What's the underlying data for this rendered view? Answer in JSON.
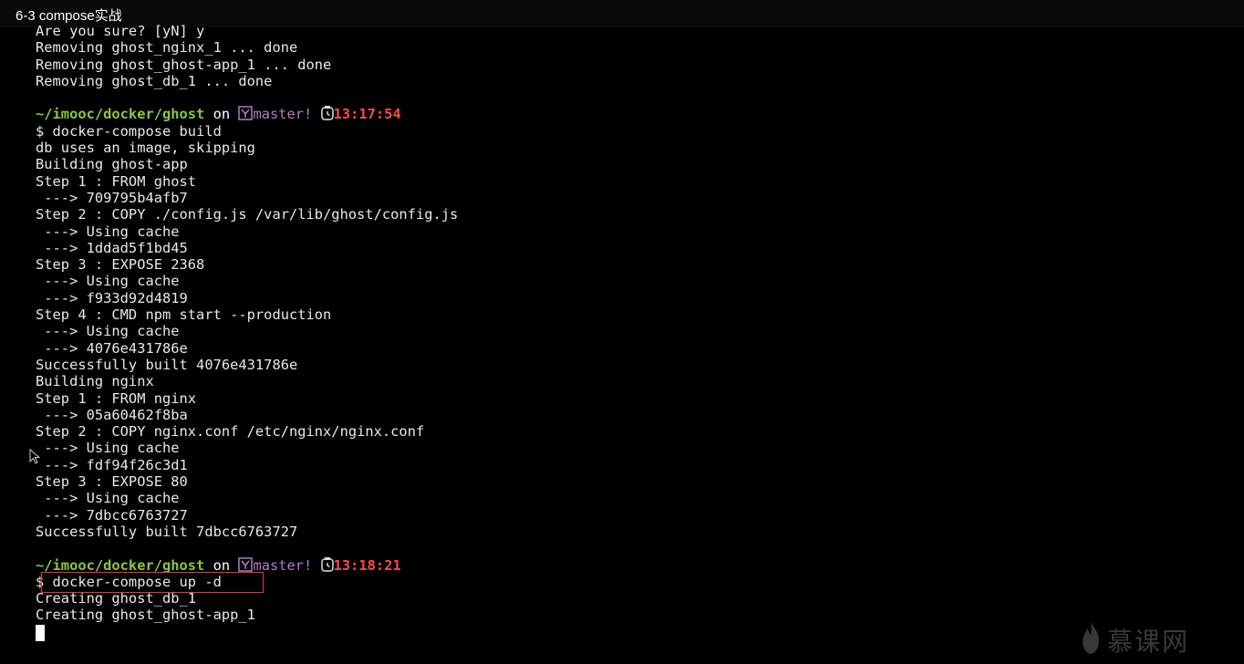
{
  "window": {
    "title": "6-3 compose实战"
  },
  "terminal": {
    "lines_top": [
      "Are you sure? [yN] y",
      "Removing ghost_nginx_1 ... done",
      "Removing ghost_ghost-app_1 ... done",
      "Removing ghost_db_1 ... done",
      ""
    ],
    "prompt1": {
      "path": "~/imooc/docker/ghost",
      "on": "on",
      "branch": "master!",
      "time": "13:17:54"
    },
    "lines_mid": [
      "$ docker-compose build",
      "db uses an image, skipping",
      "Building ghost-app",
      "Step 1 : FROM ghost",
      " ---> 709795b4afb7",
      "Step 2 : COPY ./config.js /var/lib/ghost/config.js",
      " ---> Using cache",
      " ---> 1ddad5f1bd45",
      "Step 3 : EXPOSE 2368",
      " ---> Using cache",
      " ---> f933d92d4819",
      "Step 4 : CMD npm start --production",
      " ---> Using cache",
      " ---> 4076e431786e",
      "Successfully built 4076e431786e",
      "Building nginx",
      "Step 1 : FROM nginx",
      " ---> 05a60462f8ba",
      "Step 2 : COPY nginx.conf /etc/nginx/nginx.conf",
      " ---> Using cache",
      " ---> fdf94f26c3d1",
      "Step 3 : EXPOSE 80",
      " ---> Using cache",
      " ---> 7dbcc6763727",
      "Successfully built 7dbcc6763727",
      ""
    ],
    "prompt2": {
      "path": "~/imooc/docker/ghost",
      "on": "on",
      "branch": "master!",
      "time": "13:18:21"
    },
    "lines_bottom": [
      "$ docker-compose up -d",
      "Creating ghost_db_1",
      "Creating ghost_ghost-app_1"
    ]
  },
  "watermark": {
    "text": "慕课网"
  },
  "colors": {
    "path": "#8bc34a",
    "branch": "#b07cc6",
    "time": "#ff4a4a",
    "highlight": "#e23b3b"
  }
}
